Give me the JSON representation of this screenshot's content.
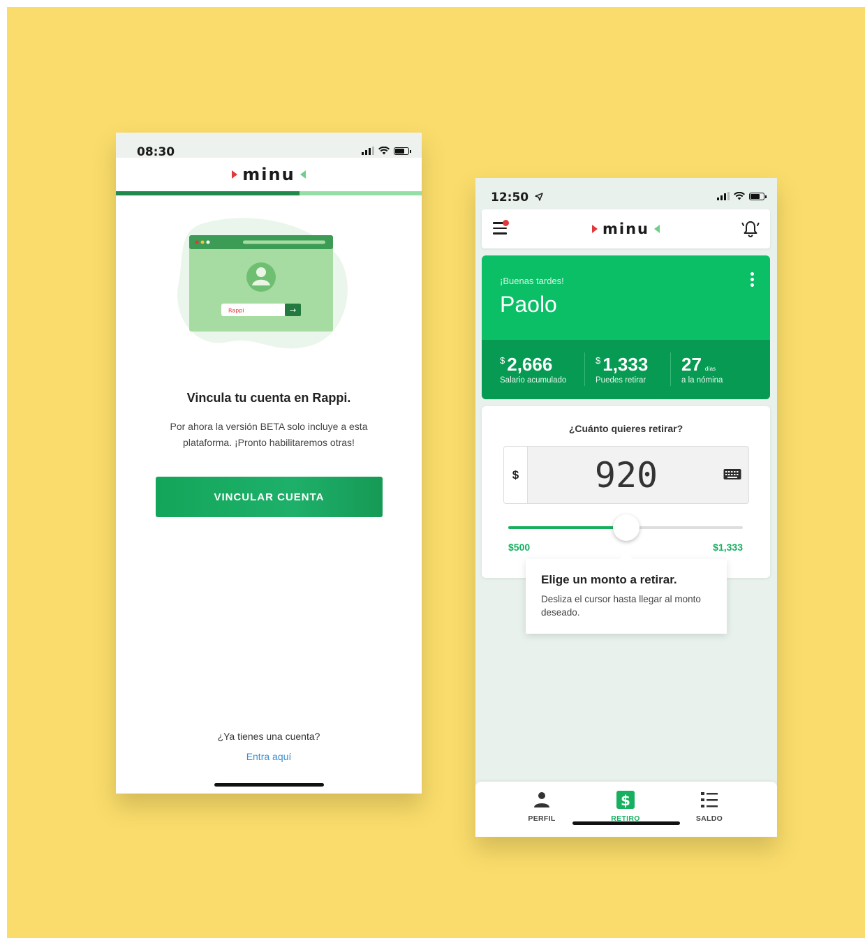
{
  "phone1": {
    "status_time": "08:30",
    "brand": "minu",
    "onboarding_progress": 0.6,
    "illustration_field": "Rappi",
    "illustration_button": "→",
    "title": "Vincula tu cuenta en Rappi.",
    "description": "Por ahora la versión BETA solo incluye a esta plataforma. ¡Pronto habilitaremos otras!",
    "button_label": "VINCULAR CUENTA",
    "have_account": "¿Ya tienes una cuenta?",
    "login_link": "Entra aquí"
  },
  "phone2": {
    "status_time": "12:50",
    "brand": "minu",
    "greeting": "¡Buenas tardes!",
    "name": "Paolo",
    "stats": [
      {
        "currency": "$",
        "value": "2,666",
        "label": "Salario acumulado"
      },
      {
        "currency": "$",
        "value": "1,333",
        "label": "Puedes retirar"
      },
      {
        "value": "27",
        "unit": "días",
        "label": "a la nómina"
      }
    ],
    "question": "¿Cuánto quieres retirar?",
    "currency_symbol": "$",
    "amount": "920",
    "slider": {
      "min": 500,
      "max": 1333,
      "value": 920,
      "min_label": "$500",
      "max_label": "$1,333"
    },
    "tooltip_title": "Elige un monto a retirar.",
    "tooltip_body": "Desliza el cursor hasta llegar al monto deseado.",
    "tabs": [
      {
        "label": "PERFIL",
        "icon": "person-icon",
        "active": false
      },
      {
        "label": "RETIRO",
        "icon": "dollar-icon",
        "active": true
      },
      {
        "label": "SALDO",
        "icon": "list-icon",
        "active": false
      }
    ]
  },
  "colors": {
    "background": "#f9dc6b",
    "brand_green": "#0bbf67",
    "dark_green": "#069a52",
    "accent_red": "#e0383b",
    "link_blue": "#3a8fd4"
  }
}
